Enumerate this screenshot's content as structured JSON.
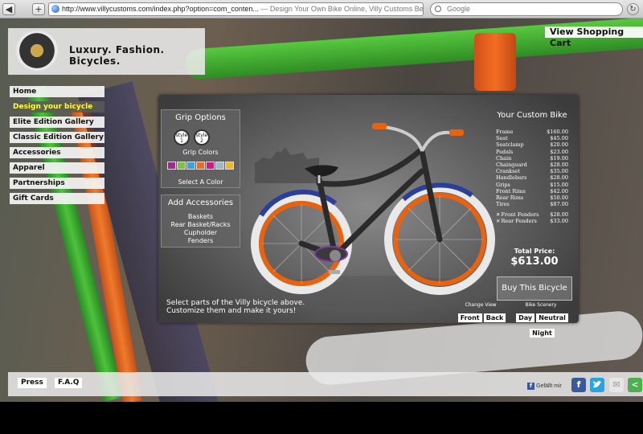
{
  "browser": {
    "back": "◀",
    "add_tab": "+",
    "url": "http://www.villycustoms.com/index.php?option=com_conten...",
    "page_title": "— Design Your Own Bike Online, Villy Customs Beach Cruiser",
    "search_placeholder": "Google"
  },
  "header": {
    "tagline": "Luxury. Fashion. Bicycles.",
    "cart_link": "View Shopping Cart"
  },
  "nav": {
    "items": [
      "Home",
      "Design your bicycle",
      "Elite Edition Gallery",
      "Classic Edition Gallery",
      "Accessories",
      "Apparel",
      "Partnerships",
      "Gift Cards"
    ],
    "active_index": 1
  },
  "grip_options": {
    "title": "Grip Options",
    "style_word": "style",
    "style_1": "1",
    "style_2": "2",
    "colors_label": "Grip Colors",
    "colors": [
      "#a8268f",
      "#7cc243",
      "#3aa3d8",
      "#f26a1b",
      "#d6168a",
      "#9fb8c8",
      "#f5b81c"
    ],
    "select_label": "Select A Color"
  },
  "accessories": {
    "title": "Add Accessories",
    "items": [
      "Baskets",
      "Rear Basket/Racks",
      "Cupholder",
      "Fenders"
    ]
  },
  "summary": {
    "title": "Your Custom Bike",
    "lines": [
      {
        "part": "Frame",
        "price": "$160.00"
      },
      {
        "part": "Seat",
        "price": "$45.00"
      },
      {
        "part": "Seatclamp",
        "price": "$20.00"
      },
      {
        "part": "Pedals",
        "price": "$23.00"
      },
      {
        "part": "Chain",
        "price": "$19.00"
      },
      {
        "part": "Chainguard",
        "price": "$28.00"
      },
      {
        "part": "Crankset",
        "price": "$35.00"
      },
      {
        "part": "Handlebars",
        "price": "$28.00"
      },
      {
        "part": "Grips",
        "price": "$15.00"
      },
      {
        "part": "Front Rims",
        "price": "$42.00"
      },
      {
        "part": "Rear Rims",
        "price": "$50.00"
      },
      {
        "part": "Tires",
        "price": "$87.00"
      }
    ],
    "extras": [
      {
        "part": "Front Fenders",
        "price": "$28.00"
      },
      {
        "part": "Rear Fenders",
        "price": "$33.00"
      }
    ],
    "remove_mark": "✕",
    "total_label": "Total Price:",
    "total_value": "$613.00",
    "buy_label": "Buy This Bicycle"
  },
  "instructions": {
    "line1": "Select parts of the Villy bicycle above.",
    "line2": "Customize them and make it yours!"
  },
  "change_view": {
    "label": "Change View",
    "front": "Front",
    "back": "Back"
  },
  "scenery": {
    "label": "Bike Scenery",
    "day": "Day",
    "neutral": "Neutral",
    "night": "Night"
  },
  "footer": {
    "press": "Press",
    "faq": "F.A.Q",
    "like": "Gefällt mir"
  },
  "social": {
    "facebook_glyph": "f",
    "email_glyph": "✉",
    "share_glyph": "<"
  },
  "colors": {
    "bike_frame": "#2b2b2b",
    "rim_accent": "#e8620f",
    "tire_white": "#e9e9e9",
    "fender_blue": "#2a3e9a",
    "bg_green": "#3cae2c",
    "bg_orange": "#f26a1b"
  }
}
